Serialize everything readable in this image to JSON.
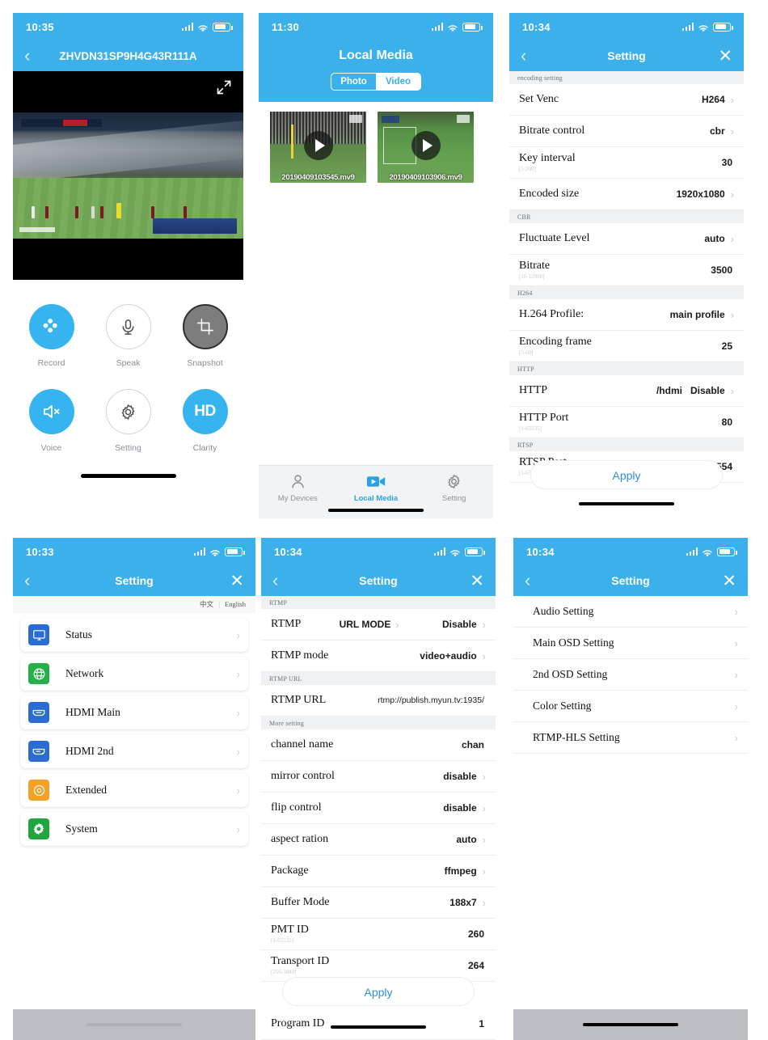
{
  "panel1": {
    "statusbar": {
      "time": "10:35"
    },
    "navbar": {
      "title": "ZHVDN31SP9H4G43R111A",
      "back_icon": "chevron-left-icon"
    },
    "video": {
      "expand_icon": "fullscreen-icon"
    },
    "controls": [
      {
        "label": "Record",
        "icon": "film-reel-icon",
        "style": "blue"
      },
      {
        "label": "Speak",
        "icon": "microphone-icon",
        "style": "outline"
      },
      {
        "label": "Snapshot",
        "icon": "crop-icon",
        "style": "ring"
      },
      {
        "label": "Voice",
        "icon": "speaker-mute-icon",
        "style": "blue"
      },
      {
        "label": "Setting",
        "icon": "gear-icon",
        "style": "outline"
      },
      {
        "label": "Clarity",
        "icon": "hd-icon",
        "style": "blue",
        "text": "HD"
      }
    ]
  },
  "panel2": {
    "statusbar": {
      "time": "11:30"
    },
    "title": "Local Media",
    "segments": [
      {
        "label": "Photo",
        "selected": true
      },
      {
        "label": "Video",
        "selected": false
      }
    ],
    "thumbnails": [
      {
        "filename": "20190409103545.mv9"
      },
      {
        "filename": "20190409103906.mv9"
      }
    ],
    "tabs": [
      {
        "label": "My Devices",
        "icon": "person-icon",
        "active": false
      },
      {
        "label": "Local Media",
        "icon": "video-camera-icon",
        "active": true
      },
      {
        "label": "Setting",
        "icon": "gear-icon",
        "active": false
      }
    ]
  },
  "panel3": {
    "statusbar": {
      "time": "10:34"
    },
    "navbar": {
      "title": "Setting",
      "back_icon": "chevron-left-icon",
      "close_icon": "close-icon"
    },
    "sections": [
      {
        "group": "encoding setting",
        "rows": [
          {
            "key": "Set Venc",
            "hint": "",
            "value": "H264",
            "arrow": true
          },
          {
            "key": "Bitrate control",
            "hint": "",
            "value": "cbr",
            "arrow": true
          },
          {
            "key": "Key interval",
            "hint": "[5-200]",
            "value": "30",
            "arrow": false
          },
          {
            "key": "Encoded size",
            "hint": "",
            "value": "1920x1080",
            "arrow": true
          }
        ]
      },
      {
        "group": "CBR",
        "rows": [
          {
            "key": "Fluctuate Level",
            "hint": "",
            "value": "auto",
            "arrow": true
          },
          {
            "key": "Bitrate",
            "hint": "[16-12000]",
            "value": "3500",
            "arrow": false
          }
        ]
      },
      {
        "group": "H264",
        "rows": [
          {
            "key": "H.264 Profile:",
            "hint": "",
            "value": "main profile",
            "arrow": true
          },
          {
            "key": "Encoding frame",
            "hint": "[5-60]",
            "value": "25",
            "arrow": false
          }
        ]
      },
      {
        "group": "HTTP",
        "rows": [
          {
            "key": "HTTP",
            "hint": "",
            "value": "/hdmi",
            "value2": "Disable",
            "arrow": true
          },
          {
            "key": "HTTP Port",
            "hint": "[1-65535]",
            "value": "80",
            "arrow": false
          }
        ]
      },
      {
        "group": "RTSP",
        "rows": [
          {
            "key": "RTSP Port",
            "hint": "[1-65535]",
            "value": "554",
            "arrow": false
          }
        ]
      }
    ],
    "apply_label": "Apply"
  },
  "panel4": {
    "statusbar": {
      "time": "10:33"
    },
    "navbar": {
      "title": "Setting",
      "back_icon": "chevron-left-icon",
      "close_icon": "close-icon"
    },
    "language": {
      "chinese": "中文",
      "english": "English",
      "separator": "|"
    },
    "menu": [
      {
        "label": "Status",
        "icon": "monitor-icon",
        "color": "blue"
      },
      {
        "label": "Network",
        "icon": "globe-icon",
        "color": "green"
      },
      {
        "label": "HDMI Main",
        "icon": "hdmi-port-icon",
        "color": "blue"
      },
      {
        "label": "HDMI 2nd",
        "icon": "hdmi-port-icon",
        "color": "blue"
      },
      {
        "label": "Extended",
        "icon": "target-icon",
        "color": "orange"
      },
      {
        "label": "System",
        "icon": "gear-icon",
        "color": "dgreen"
      }
    ]
  },
  "panel5": {
    "statusbar": {
      "time": "10:34"
    },
    "navbar": {
      "title": "Setting",
      "back_icon": "chevron-left-icon",
      "close_icon": "close-icon"
    },
    "sections": [
      {
        "group": "RTMP",
        "rows": [
          {
            "key": "RTMP",
            "hint": "",
            "value": "URL MODE",
            "value2": "Disable",
            "arrow": true
          },
          {
            "key": "RTMP mode",
            "hint": "",
            "value": "video+audio",
            "arrow": true
          }
        ]
      },
      {
        "group": "RTMP URL",
        "rows": [
          {
            "key": "RTMP URL",
            "hint": "",
            "value": "rtmp://publish.myun.tv:1935/",
            "arrow": false,
            "url": true
          }
        ]
      },
      {
        "group": "More setting",
        "rows": [
          {
            "key": "channel name",
            "hint": "",
            "value": "chan",
            "arrow": false
          },
          {
            "key": "mirror control",
            "hint": "",
            "value": "disable",
            "arrow": true
          },
          {
            "key": "flip control",
            "hint": "",
            "value": "disable",
            "arrow": true
          },
          {
            "key": "aspect ration",
            "hint": "",
            "value": "auto",
            "arrow": true
          },
          {
            "key": "Package",
            "hint": "",
            "value": "ffmpeg",
            "arrow": true
          },
          {
            "key": "Buffer Mode",
            "hint": "",
            "value": "188x7",
            "arrow": true
          },
          {
            "key": "PMT ID",
            "hint": "[1-65535]",
            "value": "260",
            "arrow": false
          },
          {
            "key": "Transport ID",
            "hint": "[256-3840]",
            "value": "264",
            "arrow": false
          }
        ]
      }
    ],
    "last_row": {
      "key": "Program ID",
      "value": "1"
    },
    "apply_label": "Apply"
  },
  "panel6": {
    "statusbar": {
      "time": "10:34"
    },
    "navbar": {
      "title": "Setting",
      "back_icon": "chevron-left-icon",
      "close_icon": "close-icon"
    },
    "items": [
      {
        "label": "Audio Setting"
      },
      {
        "label": "Main OSD Setting"
      },
      {
        "label": "2nd OSD Setting"
      },
      {
        "label": "Color Setting"
      },
      {
        "label": "RTMP-HLS Setting"
      }
    ]
  },
  "colors": {
    "header_blue": "#3bb0ea",
    "accent_blue": "#35b4ef",
    "apply_blue": "#2b8fe0",
    "group_bg": "#f0f1f2"
  }
}
